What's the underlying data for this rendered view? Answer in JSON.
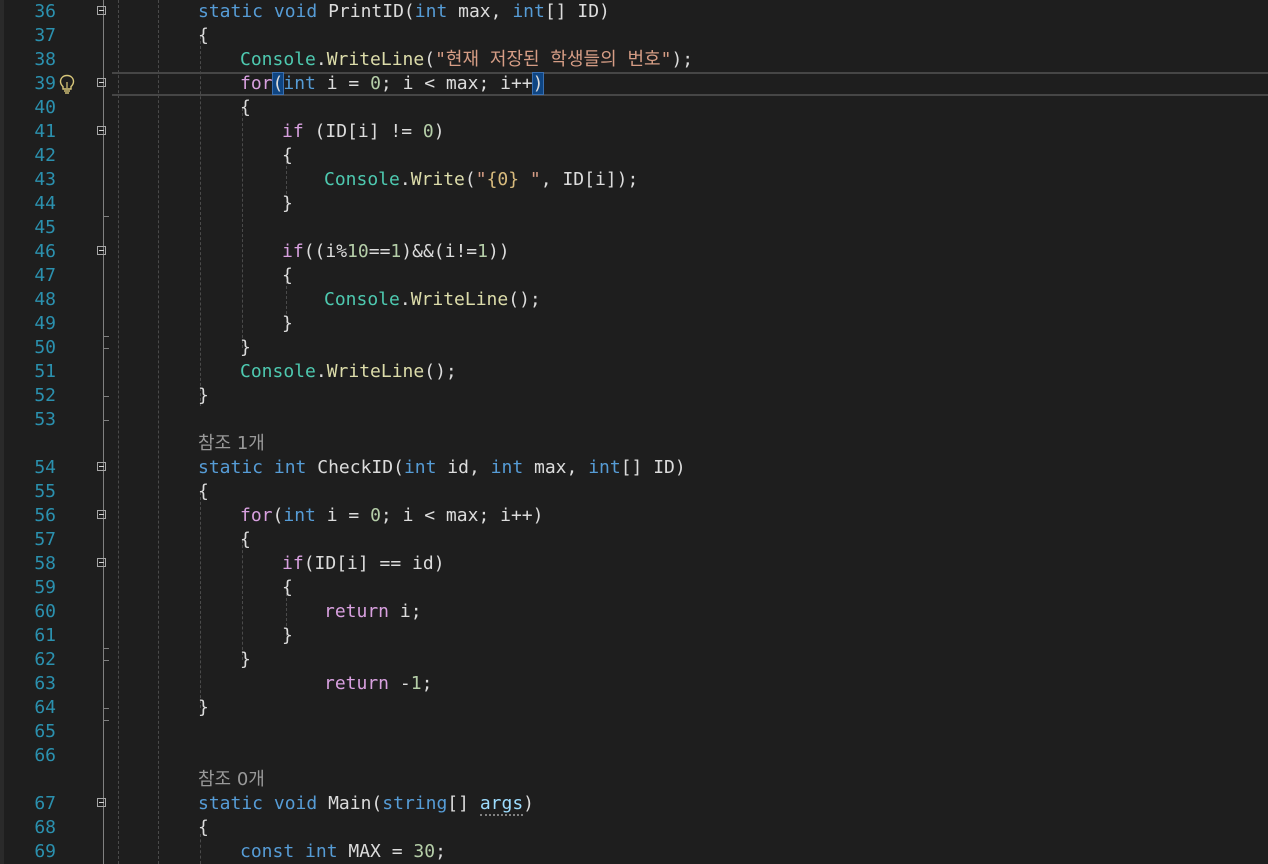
{
  "lines": [
    {
      "n": "36",
      "tokens": [
        [
          "kw",
          "static"
        ],
        [
          "plain",
          " "
        ],
        [
          "kw",
          "void"
        ],
        [
          "plain",
          " PrintID("
        ],
        [
          "kw",
          "int"
        ],
        [
          "plain",
          " max, "
        ],
        [
          "kw",
          "int"
        ],
        [
          "plain",
          "[] ID)"
        ]
      ],
      "indent": 0,
      "fold": true
    },
    {
      "n": "37",
      "tokens": [
        [
          "plain",
          "{"
        ]
      ],
      "indent": 0
    },
    {
      "n": "38",
      "tokens": [
        [
          "cls",
          "Console"
        ],
        [
          "plain",
          "."
        ],
        [
          "mth",
          "WriteLine"
        ],
        [
          "plain",
          "("
        ],
        [
          "str",
          "\"현재 저장된 학생들의 번호\""
        ],
        [
          "plain",
          ");"
        ]
      ],
      "indent": 1
    },
    {
      "n": "39",
      "tokens": [
        [
          "ctl",
          "for"
        ],
        [
          "bh",
          "("
        ],
        [
          "kw",
          "int"
        ],
        [
          "plain",
          " i = "
        ],
        [
          "num",
          "0"
        ],
        [
          "plain",
          "; i < max; i++"
        ],
        [
          "bh",
          ")"
        ]
      ],
      "indent": 1,
      "fold": true,
      "current": true
    },
    {
      "n": "40",
      "tokens": [
        [
          "plain",
          "{"
        ]
      ],
      "indent": 1
    },
    {
      "n": "41",
      "tokens": [
        [
          "ctl",
          "if"
        ],
        [
          "plain",
          " (ID[i] != "
        ],
        [
          "num",
          "0"
        ],
        [
          "plain",
          ")"
        ]
      ],
      "indent": 2,
      "fold": true
    },
    {
      "n": "42",
      "tokens": [
        [
          "plain",
          "{"
        ]
      ],
      "indent": 2
    },
    {
      "n": "43",
      "tokens": [
        [
          "cls",
          "Console"
        ],
        [
          "plain",
          "."
        ],
        [
          "mth",
          "Write"
        ],
        [
          "plain",
          "("
        ],
        [
          "str",
          "\""
        ],
        [
          "fmt",
          "{0}"
        ],
        [
          "str",
          " \""
        ],
        [
          "plain",
          ", ID[i]);"
        ]
      ],
      "indent": 3
    },
    {
      "n": "44",
      "tokens": [
        [
          "plain",
          "}"
        ]
      ],
      "indent": 2
    },
    {
      "n": "45",
      "tokens": [],
      "indent": 2
    },
    {
      "n": "46",
      "tokens": [
        [
          "ctl",
          "if"
        ],
        [
          "plain",
          "((i%"
        ],
        [
          "num",
          "10"
        ],
        [
          "plain",
          "=="
        ],
        [
          "num",
          "1"
        ],
        [
          "plain",
          ")&&(i!="
        ],
        [
          "num",
          "1"
        ],
        [
          "plain",
          "))"
        ]
      ],
      "indent": 2,
      "fold": true
    },
    {
      "n": "47",
      "tokens": [
        [
          "plain",
          "{"
        ]
      ],
      "indent": 2
    },
    {
      "n": "48",
      "tokens": [
        [
          "cls",
          "Console"
        ],
        [
          "plain",
          "."
        ],
        [
          "mth",
          "WriteLine"
        ],
        [
          "plain",
          "();"
        ]
      ],
      "indent": 3
    },
    {
      "n": "49",
      "tokens": [
        [
          "plain",
          "}"
        ]
      ],
      "indent": 2
    },
    {
      "n": "50",
      "tokens": [
        [
          "plain",
          "}"
        ]
      ],
      "indent": 1
    },
    {
      "n": "51",
      "tokens": [
        [
          "cls",
          "Console"
        ],
        [
          "plain",
          "."
        ],
        [
          "mth",
          "WriteLine"
        ],
        [
          "plain",
          "();"
        ]
      ],
      "indent": 1
    },
    {
      "n": "52",
      "tokens": [
        [
          "plain",
          "}"
        ]
      ],
      "indent": 0
    },
    {
      "n": "53",
      "tokens": [],
      "indent": 0
    },
    {
      "lens": "참조 1개"
    },
    {
      "n": "54",
      "tokens": [
        [
          "kw",
          "static"
        ],
        [
          "plain",
          " "
        ],
        [
          "kw",
          "int"
        ],
        [
          "plain",
          " CheckID("
        ],
        [
          "kw",
          "int"
        ],
        [
          "plain",
          " id, "
        ],
        [
          "kw",
          "int"
        ],
        [
          "plain",
          " max, "
        ],
        [
          "kw",
          "int"
        ],
        [
          "plain",
          "[] ID)"
        ]
      ],
      "indent": 0,
      "fold": true
    },
    {
      "n": "55",
      "tokens": [
        [
          "plain",
          "{"
        ]
      ],
      "indent": 0
    },
    {
      "n": "56",
      "tokens": [
        [
          "ctl",
          "for"
        ],
        [
          "plain",
          "("
        ],
        [
          "kw",
          "int"
        ],
        [
          "plain",
          " i = "
        ],
        [
          "num",
          "0"
        ],
        [
          "plain",
          "; i < max; i++)"
        ]
      ],
      "indent": 1,
      "fold": true
    },
    {
      "n": "57",
      "tokens": [
        [
          "plain",
          "{"
        ]
      ],
      "indent": 1
    },
    {
      "n": "58",
      "tokens": [
        [
          "ctl",
          "if"
        ],
        [
          "plain",
          "(ID[i] == id)"
        ]
      ],
      "indent": 2,
      "fold": true
    },
    {
      "n": "59",
      "tokens": [
        [
          "plain",
          "{"
        ]
      ],
      "indent": 2
    },
    {
      "n": "60",
      "tokens": [
        [
          "ctl",
          "return"
        ],
        [
          "plain",
          " i;"
        ]
      ],
      "indent": 3
    },
    {
      "n": "61",
      "tokens": [
        [
          "plain",
          "}"
        ]
      ],
      "indent": 2
    },
    {
      "n": "62",
      "tokens": [
        [
          "plain",
          "}"
        ]
      ],
      "indent": 1
    },
    {
      "n": "63",
      "tokens": [
        [
          "ctl",
          "return"
        ],
        [
          "plain",
          " -"
        ],
        [
          "num",
          "1"
        ],
        [
          "plain",
          ";"
        ]
      ],
      "indent": 3
    },
    {
      "n": "64",
      "tokens": [
        [
          "plain",
          "}"
        ]
      ],
      "indent": 0
    },
    {
      "n": "65",
      "tokens": [],
      "indent": 0
    },
    {
      "n": "66",
      "tokens": [],
      "indent": 0
    },
    {
      "lens": "참조 0개"
    },
    {
      "n": "67",
      "tokens": [
        [
          "kw",
          "static"
        ],
        [
          "plain",
          " "
        ],
        [
          "kw",
          "void"
        ],
        [
          "plain",
          " Main("
        ],
        [
          "kw",
          "string"
        ],
        [
          "plain",
          "[] "
        ],
        [
          "sq",
          "args"
        ],
        [
          "plain",
          ")"
        ]
      ],
      "indent": 0,
      "fold": true
    },
    {
      "n": "68",
      "tokens": [
        [
          "plain",
          "{"
        ]
      ],
      "indent": 0
    },
    {
      "n": "69",
      "tokens": [
        [
          "kw",
          "const"
        ],
        [
          "plain",
          " "
        ],
        [
          "kw",
          "int"
        ],
        [
          "plain",
          " MAX = "
        ],
        [
          "num",
          "30"
        ],
        [
          "plain",
          ";"
        ]
      ],
      "indent": 1
    }
  ],
  "icons": {
    "lightbulb": "lightbulb-icon",
    "fold": "collapse-icon"
  }
}
